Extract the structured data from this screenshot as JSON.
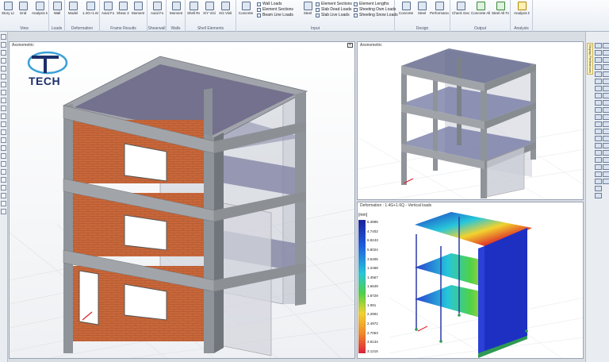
{
  "ribbon": {
    "groups": [
      {
        "label": "View",
        "buttons": [
          "Story List",
          "Grid",
          "Analysis Model"
        ]
      },
      {
        "label": "Loads",
        "buttons": [
          "Wall"
        ]
      },
      {
        "label": "Deformation",
        "buttons": [
          "Model",
          "1.4G+1.6Q"
        ]
      },
      {
        "label": "Frame Results",
        "buttons": [
          "Axial Force",
          "Shear 2-2",
          "Moment 3-3"
        ]
      },
      {
        "label": "Shearwall",
        "buttons": [
          "Axial Force"
        ]
      },
      {
        "label": "Walls",
        "buttons": [
          "Moment 3-3"
        ]
      },
      {
        "label": "Shell Elements",
        "buttons": [
          "Shell Results",
          "X/Y Visible",
          "X/2 Visible"
        ]
      },
      {
        "label": "Input",
        "buttons": [
          "Concrete"
        ]
      },
      {
        "label": "Design",
        "buttons": [
          "Concrete",
          "Steel",
          "Performance"
        ]
      },
      {
        "label": "Output",
        "buttons": [
          "Check Geometry",
          "Concrete All Failures",
          "Steel All Failures"
        ]
      },
      {
        "label": "Analysis",
        "buttons": [
          "Analysis Design"
        ]
      }
    ],
    "list_col_1": [
      "Wall Loads",
      "Element Sections",
      "Beam Line Loads"
    ],
    "list_col_2": [
      "Element Sections",
      "Slab Dead Loads",
      "Slab Live Loads"
    ],
    "list_col_3": [
      "Element Lengths",
      "Sheeting Own Loads",
      "Sheeting Snow Loads"
    ],
    "input_btn": "Steel"
  },
  "viewports": {
    "main": {
      "title": "Axonometric"
    },
    "top_right": {
      "title": "Axonometric"
    },
    "bottom_right": {
      "title": "Deformation : 1.4G+1.6Q - Vertical loads"
    }
  },
  "logo": {
    "text": "TECH"
  },
  "legend": {
    "unit": "[mm]",
    "values": [
      "5.3995",
      "4.7402",
      "6.8243",
      "5.8024",
      "3.6405",
      "1.2468",
      "1.4567",
      "1.6649",
      "1.8729",
      "1.081",
      "2.2891",
      "2.4972",
      "2.7053",
      "3.9134",
      "3.1215"
    ]
  },
  "right_toolbar": {
    "tab_label": "Display Preferences"
  },
  "left_toolbar": {
    "tab_label": "Structure"
  },
  "colors": {
    "brick": "#c9673a",
    "concrete": "#8e9499",
    "slab": "#7d7fa0",
    "glass": "#c9ccd6"
  }
}
